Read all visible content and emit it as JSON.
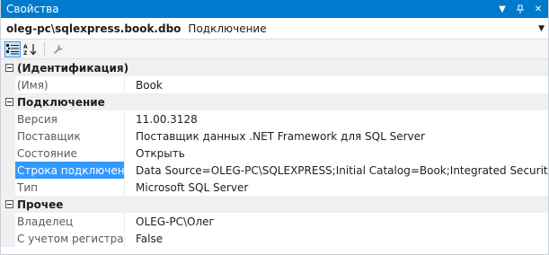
{
  "window": {
    "title": "Свойства"
  },
  "object": {
    "name": "oleg-pc\\sqlexpress.book.dbo",
    "type": "Подключение"
  },
  "categories": [
    {
      "label": "(Идентификация)",
      "rows": [
        {
          "name": "(Имя)",
          "value": "Book"
        }
      ]
    },
    {
      "label": "Подключение",
      "rows": [
        {
          "name": "Версия",
          "value": "11.00.3128"
        },
        {
          "name": "Поставщик",
          "value": "Поставщик данных .NET Framework для SQL Server"
        },
        {
          "name": "Состояние",
          "value": "Открыть"
        },
        {
          "name": "Строка подключения",
          "value": "Data Source=OLEG-PC\\SQLEXPRESS;Initial Catalog=Book;Integrated Security=True"
        },
        {
          "name": "Тип",
          "value": "Microsoft SQL Server"
        }
      ]
    },
    {
      "label": "Прочее",
      "rows": [
        {
          "name": "Владелец",
          "value": "OLEG-PC\\Олег"
        },
        {
          "name": "С учетом регистра",
          "value": "False"
        }
      ]
    }
  ],
  "colors": {
    "accent": "#007acc",
    "selection": "#3399ff"
  },
  "icons": {
    "categorized": "categorized-icon",
    "alphabetical": "alphabetical-icon",
    "property-pages": "wrench-icon"
  }
}
